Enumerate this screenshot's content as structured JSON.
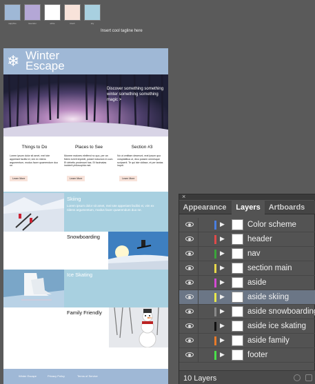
{
  "swatches": {
    "colors": [
      "#9fb8d6",
      "#b4a7d6",
      "#ffffff",
      "#f8e3da",
      "#a8d0e0"
    ],
    "labels": [
      "sapphire",
      "lavender",
      "white",
      "blush",
      "sky"
    ]
  },
  "tagline": "Insert cool tagline here",
  "site": {
    "logo_line1": "Winter",
    "logo_line2": "Escape",
    "hero_text": "Discover something something winter something something magic >",
    "columns": [
      {
        "title": "Things to Do",
        "body": "Lorem ipsum dolor sit amet, mei tote apperiant facilisi ei, vim ex ridens argumentum, modus facer quaerendum duo ne.",
        "link": "Learn More"
      },
      {
        "title": "Places to See",
        "body": "Munere maiores eleifend no quo, per an fidem everti impedit, putant indoctum in cum. Et debetis prodesset has. Et facimatas inciderit philosophia mei.",
        "link": "Learn More"
      },
      {
        "title": "Section #3",
        "body": "No ut omittam deserunt, erat ipsum quo voluptatibus ut, dico possim omnesque scripserit. Te qui iste vidisse, et per tantas inquit.",
        "link": "Learn More"
      }
    ],
    "skiing_title": "Skiing",
    "skiing_body": "Lorem ipsum dolor sit amet, mei tote apperiant facilisi ei, vim ex ridens argumentum, modus facer quaerendum duo ne.",
    "snowboarding_title": "Snowboarding",
    "ice_title": "Ice Skating",
    "family_title": "Family Friendly",
    "footer_links": [
      "Winter Escape",
      "Privacy Policy",
      "Terms of Service"
    ]
  },
  "layers_panel": {
    "tabs": [
      "Appearance",
      "Layers",
      "Artboards"
    ],
    "active_tab": "Layers",
    "layers": [
      {
        "name": "Color scheme",
        "color": "#4a7fe0"
      },
      {
        "name": "header",
        "color": "#e04a4a"
      },
      {
        "name": "nav",
        "color": "#3aa63a"
      },
      {
        "name": "section main",
        "color": "#e8d84a"
      },
      {
        "name": "aside",
        "color": "#d44ad4"
      },
      {
        "name": "aside skiing",
        "color": "#e8e84a",
        "selected": true
      },
      {
        "name": "aside snowboarding",
        "color": "#888888"
      },
      {
        "name": "aside ice skating",
        "color": "#111111"
      },
      {
        "name": "aside family",
        "color": "#e87a2a"
      },
      {
        "name": "footer",
        "color": "#4ae04a"
      }
    ],
    "count_label": "10 Layers"
  }
}
